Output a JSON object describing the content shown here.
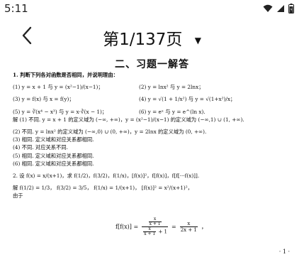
{
  "status_bar": {
    "time": "5:11",
    "icons": [
      "wifi-icon",
      "signal-icon",
      "battery-icon"
    ]
  },
  "header": {
    "back_icon": "chevron-left-icon",
    "page_indicator": "第1/137页",
    "dropdown_icon": "caret-down-icon"
  },
  "document": {
    "section_title": "二、习题一解答",
    "q1_prompt": "1. 判断下列各对函数是否相同，并说明理由：",
    "q1_items": [
      {
        "left": "(1) y = x + 1 与 y = (x²−1)/(x−1)；",
        "right": "(2) y = lnx² 与 y = 2lnx；"
      },
      {
        "left": "(3) y = f(x) 与 x = f(y)；",
        "right": "(4) y = √(1 + 1/x²) 与 y = √(1+x²)/x；"
      },
      {
        "left": "(5) y = ∛(x⁴ − x³) 与 y = x·∛(x − 1)；",
        "right": "(6) y = eˣ 与 y = e^(ln x)."
      }
    ],
    "answer_lines": [
      "解  (1) 不同. y = x + 1 的定义域为 (−∞, +∞)，y = (x²−1)/(x−1) 的定义域为 (−∞,1) ∪ (1, +∞).",
      "(2) 不同. y = lnx² 的定义域为 (−∞,0) ∪ (0, +∞)，y = 2lnx 的定义域为 (0, +∞).",
      "(3) 相同. 定义域和对应关系都相同.",
      "(4) 不同. 对应关系不同.",
      "(5) 相同. 定义域和对应关系都相同.",
      "(6) 相同. 定义域和对应关系都相同."
    ],
    "q2_line": "2. 设 f(x) = x/(x+1)，求 f(1/2)，f(3/2)，f(1/x)，[f(x)]²，f[f(x)]，f[f[···f(x)]].",
    "q2_solution": "解  f(1/2) = 1/3，  f(3/2) = 3/5，  f(1/x) = 1/(x+1)，  [f(x)]² = x²/(x+1)²，",
    "q2_because": "由于",
    "formula_lhs": "f[f(x)] =",
    "formula_num_top": "x",
    "formula_num_bot": "x + 1",
    "formula_den_top": "x",
    "formula_den_tail": "x + 1",
    "formula_den_plus": "+ 1",
    "formula_rhs": "=",
    "formula_rhs_num": "x",
    "formula_rhs_den": "2x + 1",
    "formula_end": "，",
    "page_number": "· 1 ·"
  }
}
